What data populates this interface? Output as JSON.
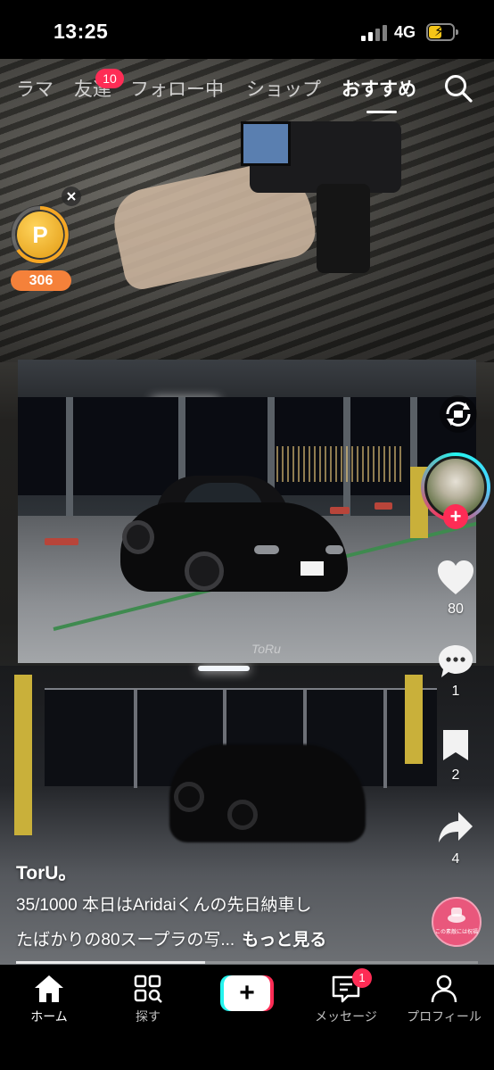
{
  "status_bar": {
    "time": "13:25",
    "network": "4G"
  },
  "top_nav": {
    "tabs": [
      {
        "label": "ラマ",
        "active": false
      },
      {
        "label": "友達",
        "active": false
      },
      {
        "label": "フォロー中",
        "active": false
      },
      {
        "label": "ショップ",
        "active": false
      },
      {
        "label": "おすすめ",
        "active": true
      }
    ],
    "friends_badge": "10"
  },
  "coin_widget": {
    "count": "306",
    "symbol": "P"
  },
  "photo": {
    "watermark": "ToRu"
  },
  "actions": {
    "likes": "80",
    "comments": "1",
    "saves": "2",
    "shares": "4"
  },
  "music": {
    "disc_text": "この素敵には祝福がな"
  },
  "caption": {
    "username": "TorU。",
    "line1": "35/1000 本日はAridaiくんの先日納車し",
    "line2": "たばかりの80スープラの写...",
    "more": "もっと見る"
  },
  "progress": {
    "fraction": 0.41
  },
  "bottom_nav": {
    "items": [
      {
        "label": "ホーム",
        "icon": "home-icon",
        "active": true
      },
      {
        "label": "探す",
        "icon": "explore-icon",
        "active": false
      },
      {
        "label": "",
        "icon": "create-plus-icon",
        "active": false
      },
      {
        "label": "メッセージ",
        "icon": "inbox-icon",
        "active": false
      },
      {
        "label": "プロフィール",
        "icon": "profile-icon",
        "active": false
      }
    ],
    "messages_badge": "1"
  },
  "colors": {
    "accent": "#fe2c55",
    "cyan": "#25f4ee",
    "coin_orange": "#f5813a"
  }
}
